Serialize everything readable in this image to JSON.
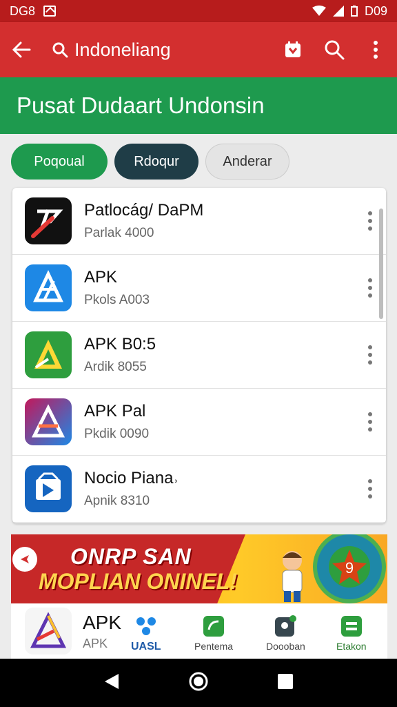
{
  "status_bar": {
    "time": "DG8",
    "battery": "D09"
  },
  "toolbar": {
    "title": "Indoneliang"
  },
  "banner": {
    "title": "Pusat Dudaart Undonsin"
  },
  "chips": [
    "Poqoual",
    "Rdoqur",
    "Anderar"
  ],
  "apps": [
    {
      "name": "Patlocág/ DaPM",
      "sub": "Parlak 4000",
      "icon": "stylus-icon"
    },
    {
      "name": "APK",
      "sub": "Pkols A003",
      "icon": "apk-blue-icon"
    },
    {
      "name": "APK  B0:5",
      "sub": "Ardik 8055",
      "icon": "apk-green-icon"
    },
    {
      "name": "APK Pal",
      "sub": "Pkdik 0090",
      "icon": "apk-red-icon"
    },
    {
      "name": "Nocio Piana˒",
      "sub": "Apnik 8310",
      "icon": "apk-dark-icon"
    }
  ],
  "promo": {
    "line1": "ONRP SAN",
    "line2": "MOPLIAN ONINEL!"
  },
  "bottom": {
    "apk_name": "APK",
    "apk_sub": "APK",
    "items": [
      {
        "label": "UASL"
      },
      {
        "label": "Pentema"
      },
      {
        "label": "Doooban"
      },
      {
        "label": "Etakon"
      }
    ]
  },
  "colors": {
    "primary": "#d32f2f",
    "secondary": "#1e9a4e",
    "dark_chip": "#1f3d47"
  }
}
